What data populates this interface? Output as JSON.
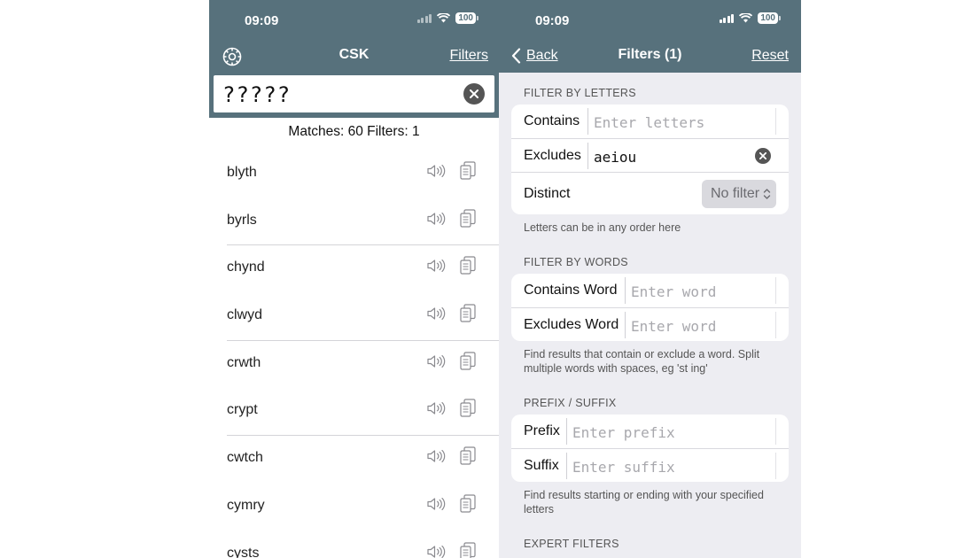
{
  "left": {
    "status": {
      "time": "09:09",
      "battery": "100"
    },
    "nav": {
      "title": "CSK",
      "filters_label": "Filters"
    },
    "search": {
      "value": "?????"
    },
    "matches_text": "Matches: 60 Filters: 1",
    "words": [
      "blyth",
      "byrls",
      "chynd",
      "clwyd",
      "crwth",
      "crypt",
      "cwtch",
      "cymry",
      "cysts"
    ],
    "icons": {
      "settings": "gear-icon",
      "speaker": "speaker-icon",
      "copy": "copy-icon",
      "clear": "clear-icon"
    }
  },
  "right": {
    "status": {
      "time": "09:09",
      "battery": "100"
    },
    "nav": {
      "back_label": "Back",
      "title": "Filters (1)",
      "reset_label": "Reset"
    },
    "letters": {
      "header": "FILTER BY LETTERS",
      "contains_label": "Contains",
      "contains_placeholder": "Enter letters",
      "excludes_label": "Excludes",
      "excludes_value": "aeiou",
      "distinct_label": "Distinct",
      "distinct_value": "No filter",
      "help": "Letters can be in any order here"
    },
    "words": {
      "header": "FILTER BY WORDS",
      "contains_label": "Contains Word",
      "contains_placeholder": "Enter word",
      "excludes_label": "Excludes Word",
      "excludes_placeholder": "Enter word",
      "help": "Find results that contain or exclude a word. Split multiple words with spaces, eg 'st ing'"
    },
    "prefix": {
      "header": "PREFIX / SUFFIX",
      "prefix_label": "Prefix",
      "prefix_placeholder": "Enter prefix",
      "suffix_label": "Suffix",
      "suffix_placeholder": "Enter suffix",
      "help": "Find results starting or ending with your specified letters"
    },
    "expert": {
      "header": "EXPERT FILTERS"
    }
  },
  "colors": {
    "header": "#57717c",
    "background": "#ededf2",
    "card": "#ffffff"
  }
}
